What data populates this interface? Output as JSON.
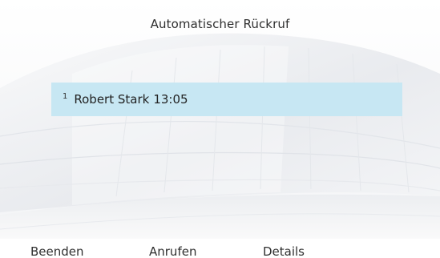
{
  "screen": {
    "title": "Automatischer Rückruf"
  },
  "list": {
    "items": [
      {
        "index": "1",
        "name": "Robert Stark",
        "time": "13:05",
        "selected": true
      }
    ]
  },
  "softkeys": [
    {
      "label": "Beenden"
    },
    {
      "label": "Anrufen"
    },
    {
      "label": "Details"
    }
  ],
  "colors": {
    "selection": "#c7e7f3",
    "text": "#222222",
    "background": "#ffffff"
  }
}
